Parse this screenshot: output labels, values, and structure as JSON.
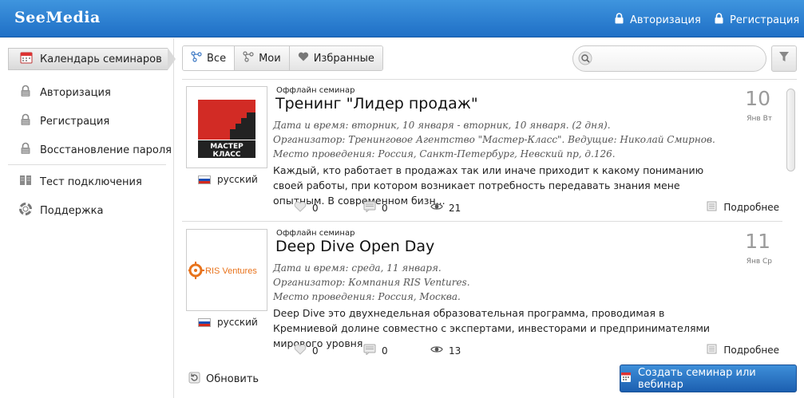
{
  "app": {
    "title": "SeeMedia"
  },
  "header": {
    "login_label": "Авторизация",
    "register_label": "Регистрация"
  },
  "sidebar": {
    "active_label": "Календарь семинаров",
    "items": [
      {
        "label": "Авторизация"
      },
      {
        "label": "Регистрация"
      },
      {
        "label": "Восстановление пароля"
      },
      {
        "label": "Тест подключения"
      },
      {
        "label": "Поддержка"
      }
    ]
  },
  "tabs": [
    {
      "label": "Все"
    },
    {
      "label": "Мои"
    },
    {
      "label": "Избранные"
    }
  ],
  "search": {
    "placeholder": ""
  },
  "cards": [
    {
      "type": "Оффлайн семинар",
      "title": "Тренинг \"Лидер продаж\"",
      "datetime": "Дата и время: вторник, 10 января - вторник, 10 января. (2 дня).",
      "organizer": "Организатор: Тренинговое Агентство \"Мастер-Класс\". Ведущие: Николай Смирнов.",
      "place": "Место проведения: Россия, Санкт-Петербург, Невский пр, д.126.",
      "description": "Каждый, кто работает в продажах так или иначе приходит к какому пониманию своей работы, при котором возникает потребность передавать знания мене опытным. В современном бизн...",
      "day": "10",
      "dow": "Янв Вт",
      "language": "русский",
      "likes": "0",
      "comments": "0",
      "views": "21",
      "more_label": "Подробнее",
      "logo_text_line1": "МАСТЕР",
      "logo_text_line2": "КЛАСС"
    },
    {
      "type": "Оффлайн семинар",
      "title": "Deep Dive Open Day",
      "datetime": "Дата и время: среда, 11 января.",
      "organizer": "Организатор: Компания RIS Ventures.",
      "place": "Место проведения: Россия, Москва.",
      "description": "Deep Dive это двухнедельная образовательная программа, проводимая в Кремниевой долине совместно с экспертами, инвесторами и предпринимателями мирового уровня.",
      "day": "11",
      "dow": "Янв Ср",
      "language": "русский",
      "likes": "0",
      "comments": "0",
      "views": "13",
      "more_label": "Подробнее",
      "logo_text": "RIS Ventures"
    }
  ],
  "footer": {
    "refresh_label": "Обновить",
    "create_label": "Создать семинар или вебинар"
  },
  "colors": {
    "header_top": "#3f95de",
    "header_bottom": "#1f6fc6",
    "button_blue": "#1c5fb0",
    "logo_red": "#d22b25",
    "ris_orange": "#e8731c"
  }
}
